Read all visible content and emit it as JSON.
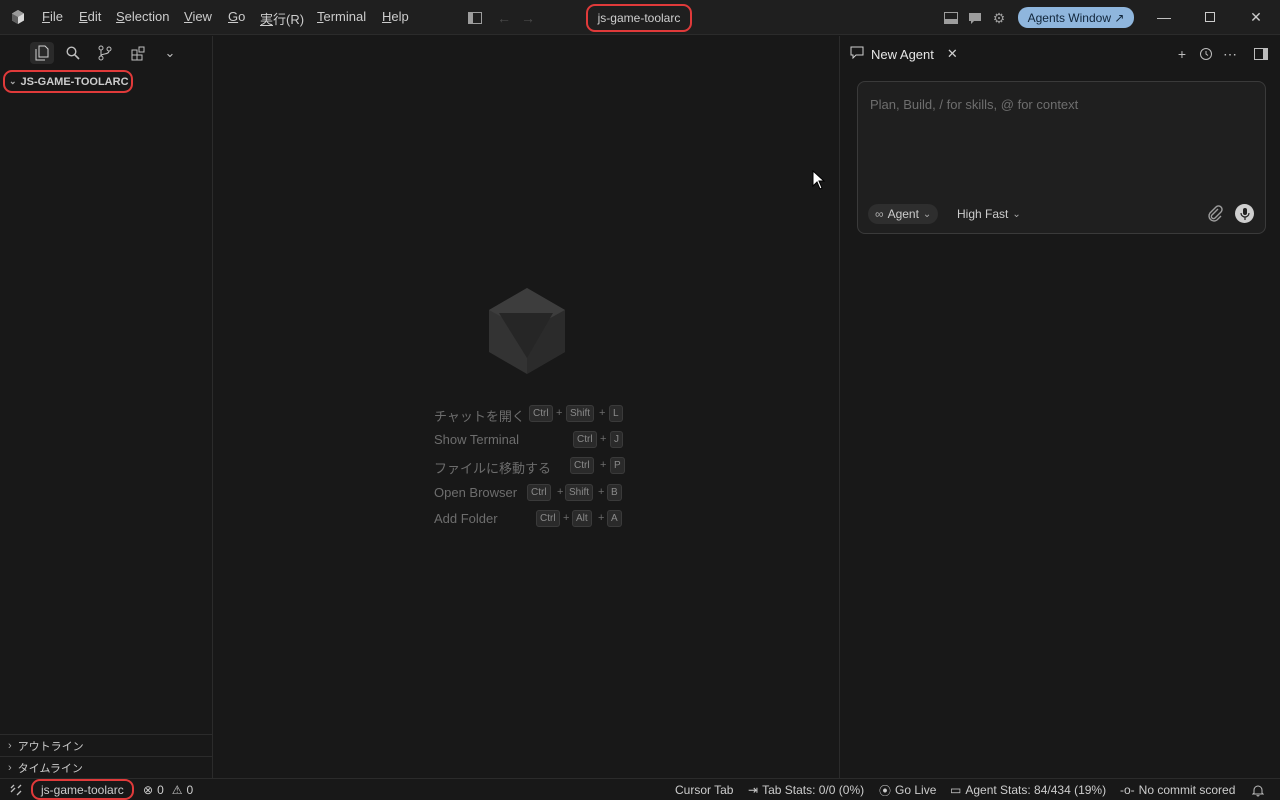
{
  "titlebar": {
    "menu": [
      "File",
      "Edit",
      "Selection",
      "View",
      "Go",
      "実行(R)",
      "Terminal",
      "Help"
    ],
    "title": "js-game-toolarc",
    "agents_window_label": "Agents Window ↗",
    "icons": [
      "app-logo-icon",
      "toggle-sidebar-icon",
      "back-arrow-icon",
      "forward-arrow-icon",
      "panel-layout-icon",
      "chat-icon",
      "settings-gear-icon",
      "minimize-icon",
      "maximize-icon",
      "close-icon"
    ]
  },
  "sidebar": {
    "tabs": [
      "explorer-icon",
      "search-icon",
      "source-control-icon",
      "extensions-icon",
      "chevron-down-icon"
    ],
    "folder_name": "JS-GAME-TOOLARC",
    "bottom_sections": [
      "アウトライン",
      "タイムライン"
    ]
  },
  "editor": {
    "shortcuts": [
      {
        "label": "チャットを開く",
        "keys": [
          "Ctrl",
          "Shift",
          "L"
        ]
      },
      {
        "label": "Show Terminal",
        "keys": [
          "Ctrl",
          "J"
        ]
      },
      {
        "label": "ファイルに移動する",
        "keys": [
          "Ctrl",
          "P"
        ]
      },
      {
        "label": "Open Browser",
        "keys": [
          "Ctrl",
          "Shift",
          "B"
        ]
      },
      {
        "label": "Add Folder",
        "keys": [
          "Ctrl",
          "Alt",
          "A"
        ]
      }
    ]
  },
  "agent_panel": {
    "tab_label": "New Agent",
    "input_placeholder": "Plan, Build, / for skills, @ for context",
    "mode_label": "Agent",
    "model_label": "High Fast"
  },
  "statusbar": {
    "workspace": "js-game-toolarc",
    "errors": "0",
    "warnings": "0",
    "cursor_tab": "Cursor Tab",
    "tab_stats": "Tab Stats: 0/0 (0%)",
    "go_live": "Go Live",
    "agent_stats": "Agent Stats: 84/434 (19%)",
    "commit": "No commit scored"
  },
  "colors": {
    "background": "#181818",
    "accent_button": "#8fb6dd",
    "highlight_outline": "#e03a3a"
  }
}
